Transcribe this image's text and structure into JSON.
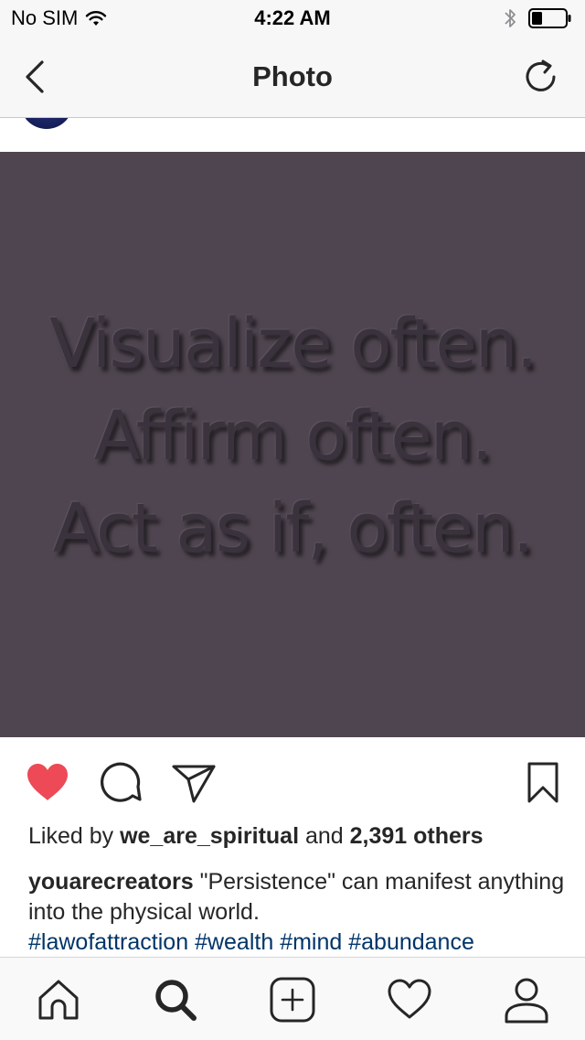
{
  "status_bar": {
    "carrier": "No SIM",
    "time": "4:22 AM",
    "wifi_icon": "wifi-icon",
    "bluetooth_icon": "bluetooth-icon",
    "battery_icon": "battery-icon",
    "battery_level": 0.3
  },
  "nav": {
    "title": "Photo",
    "back_icon": "chevron-left-icon",
    "refresh_icon": "refresh-icon"
  },
  "post": {
    "photo_text": [
      "Visualize often.",
      "Affirm often.",
      "Act as if, often."
    ],
    "photo_bg": "#4f4550",
    "liked": true,
    "like_color": "#ed4956",
    "likes_prefix": "Liked by",
    "liked_by_user": "we_are_spiritual",
    "likes_and": "and",
    "likes_others": "2,391 others",
    "caption_user": "youarecreators",
    "caption_text": " \"Persistence\" can manifest anything into the physical world.",
    "hashtags": [
      "#lawofattraction",
      "#wealth",
      "#mind",
      "#abundance"
    ],
    "hashtag_color": "#003569"
  },
  "tab_bar": {
    "items": [
      "home-icon",
      "search-icon",
      "add-post-icon",
      "activity-heart-icon",
      "profile-icon"
    ],
    "active": "search-icon"
  }
}
